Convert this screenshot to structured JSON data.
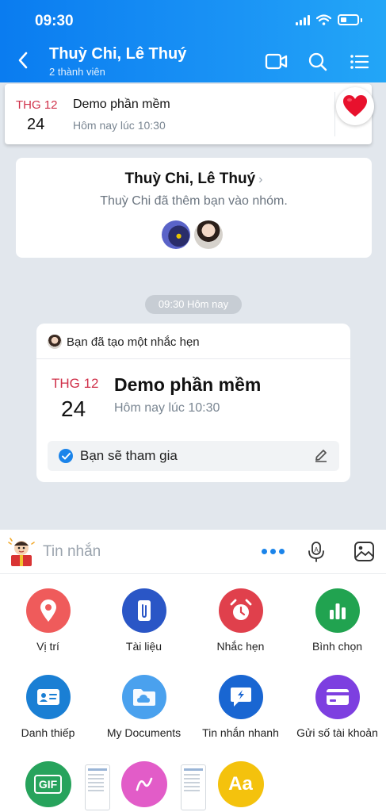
{
  "status_bar": {
    "time": "09:30"
  },
  "header": {
    "title": "Thuỳ Chi, Lê Thuý",
    "subtitle": "2 thành viên"
  },
  "pinned_reminder": {
    "month": "THG 12",
    "day": "24",
    "title": "Demo phần mềm",
    "time": "Hôm nay lúc 10:30"
  },
  "group_card": {
    "name": "Thuỳ Chi, Lê Thuý",
    "chevron": "›",
    "description": "Thuỳ Chi đã thêm bạn vào nhóm."
  },
  "time_divider": "09:30 Hôm nay",
  "reminder_message": {
    "header": "Bạn đã tạo một nhắc hẹn",
    "month": "THG 12",
    "day": "24",
    "title": "Demo phần mềm",
    "time": "Hôm nay lúc 10:30",
    "rsvp_label": "Bạn sẽ tham gia"
  },
  "composer": {
    "placeholder": "Tin nhắn"
  },
  "attachments": [
    {
      "label": "Vị trí",
      "icon": "location-pin-icon",
      "color": "#ef5b5b"
    },
    {
      "label": "Tài liệu",
      "icon": "paperclip-icon",
      "color": "#2a56c6"
    },
    {
      "label": "Nhắc hẹn",
      "icon": "alarm-clock-icon",
      "color": "#e0404c"
    },
    {
      "label": "Bình chọn",
      "icon": "poll-chart-icon",
      "color": "#21a350"
    },
    {
      "label": "Danh thiếp",
      "icon": "contact-card-icon",
      "color": "#1a7fd4"
    },
    {
      "label": "My Documents",
      "icon": "cloud-folder-icon",
      "color": "#4aa1ee"
    },
    {
      "label": "Tin nhắn nhanh",
      "icon": "quick-message-icon",
      "color": "#1966d2"
    },
    {
      "label": "Gửi số tài khoản",
      "icon": "bank-card-icon",
      "color": "#7d3fe0"
    }
  ],
  "last_row": {
    "font_tile_glyph": "Aa",
    "gif_label": "GIF"
  },
  "colors": {
    "header_blue": "#0a7cf0",
    "accent_blue": "#1b84ea",
    "date_red": "#d0314a",
    "background": "#e2e7ed"
  }
}
